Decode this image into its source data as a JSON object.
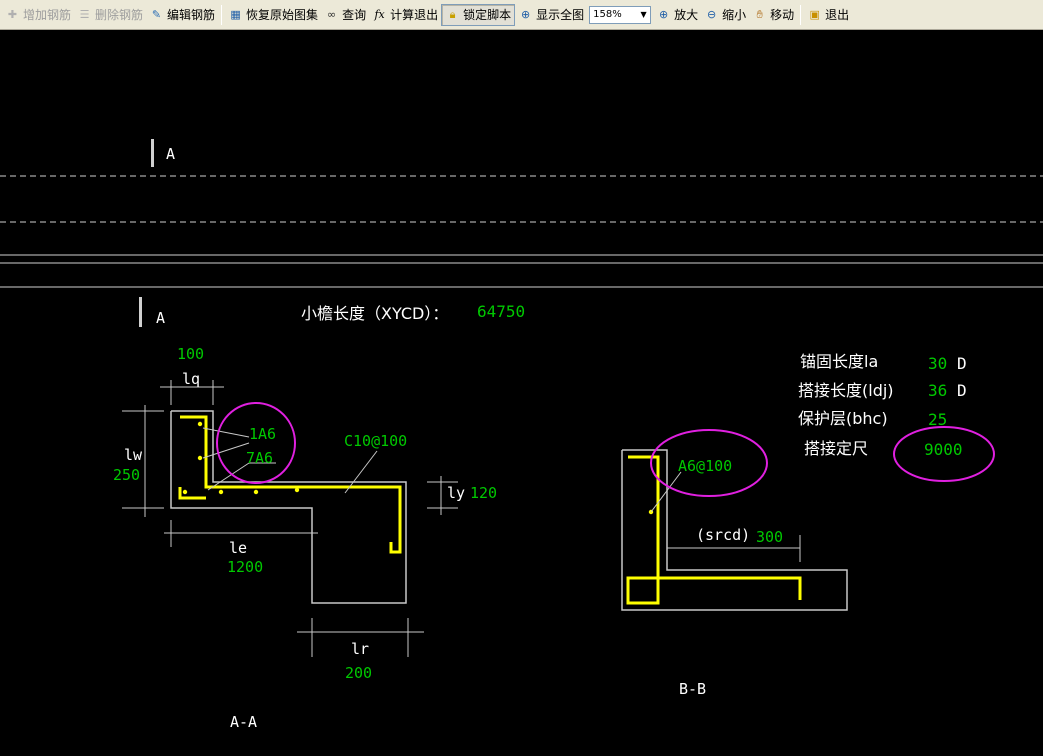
{
  "toolbar": {
    "add_rebar": "增加钢筋",
    "delete_rebar": "删除钢筋",
    "edit_rebar": "编辑钢筋",
    "restore_atlas": "恢复原始图集",
    "query": "查询",
    "calc_exit": "计算退出",
    "lock_script": "锁定脚本",
    "show_all": "显示全图",
    "zoom_value": "158%",
    "zoom_in": "放大",
    "zoom_out": "缩小",
    "move": "移动",
    "exit": "退出"
  },
  "drawing": {
    "section_mark_top": "A",
    "section_mark_bottom": "A",
    "eave_length_label": "小檐长度（XYCD）：",
    "eave_length_value": "64750",
    "aa": {
      "lq_value": "100",
      "lq_label": "lq",
      "lw_label": "lw",
      "lw_value": "250",
      "rebar_1": "1A6",
      "rebar_7": "7A6",
      "main_rebar": "C10@100",
      "ly_label": "ly",
      "ly_value": "120",
      "le_label": "le",
      "le_value": "1200",
      "lr_label": "lr",
      "lr_value": "200",
      "title": "A-A"
    },
    "bb": {
      "rebar": "A6@100",
      "srcd_label": "(srcd)",
      "srcd_value": "300",
      "title": "B-B"
    },
    "params": {
      "anchor_label": "锚固长度la",
      "anchor_value": "30",
      "anchor_unit": "D",
      "lap_label": "搭接长度(ldj)",
      "lap_value": "36",
      "lap_unit": "D",
      "cover_label": "保护层(bhc)",
      "cover_value": "25",
      "fixed_label": "搭接定尺",
      "fixed_value": "9000"
    }
  },
  "colors": {
    "background": "#000000",
    "outline": "#c8c8c8",
    "rebar": "#ffff00",
    "value_text": "#00c800",
    "label_text": "#ffffff",
    "highlight_circle": "#e020e0"
  }
}
